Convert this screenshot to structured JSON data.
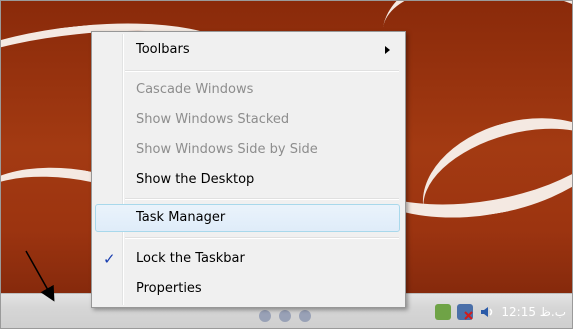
{
  "context_menu": {
    "items": [
      {
        "label": "Toolbars",
        "enabled": true,
        "has_submenu": true
      },
      {
        "label": "Cascade Windows",
        "enabled": false
      },
      {
        "label": "Show Windows Stacked",
        "enabled": false
      },
      {
        "label": "Show Windows Side by Side",
        "enabled": false
      },
      {
        "label": "Show the Desktop",
        "enabled": true
      },
      {
        "label": "Task Manager",
        "enabled": true,
        "highlighted": true
      },
      {
        "label": "Lock the Taskbar",
        "enabled": true,
        "checked": true
      },
      {
        "label": "Properties",
        "enabled": true
      }
    ]
  },
  "taskbar": {
    "clock": "12:15 ب.ظ"
  },
  "colors": {
    "wallpaper": "#9c3410",
    "menu_bg": "#f0f0f0",
    "highlight_border": "#a8d8eb",
    "check_color": "#1a3fb0"
  },
  "icons": [
    "submenu-arrow-icon",
    "checkmark-icon",
    "volume-icon",
    "network-icon",
    "tray-app-icon"
  ]
}
